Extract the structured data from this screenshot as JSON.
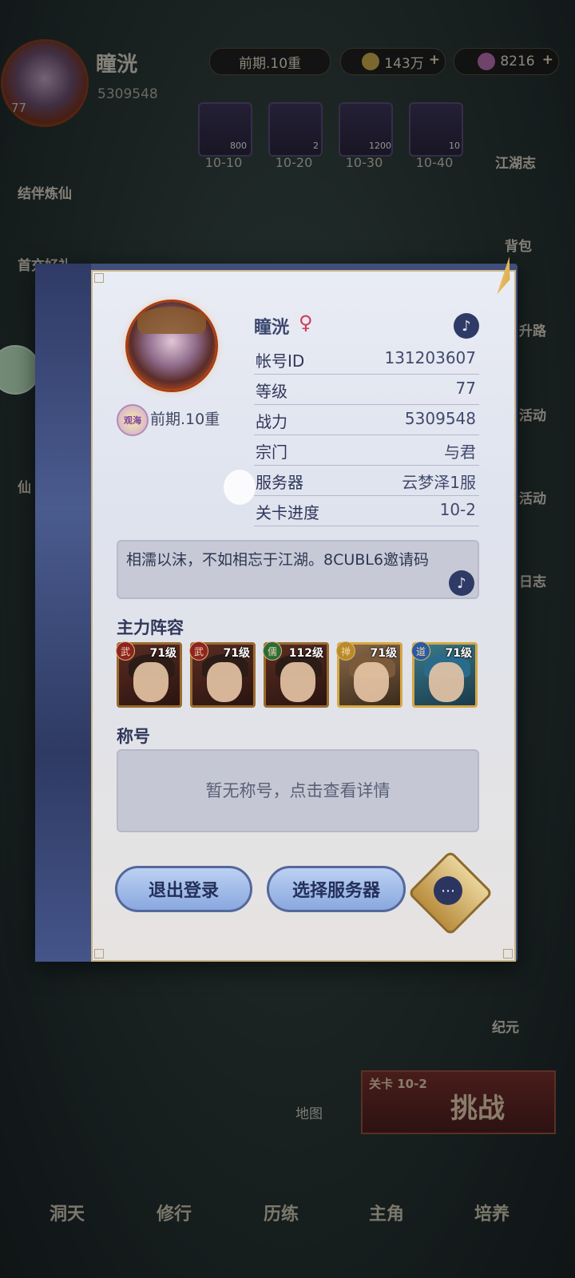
{
  "top": {
    "player_name": "瞳洸",
    "level": "77",
    "power": "5309548",
    "rank_badge": "观海",
    "rank_text": "前期.10重",
    "coins": "143万",
    "gems": "8216",
    "plus": "+"
  },
  "rewards": [
    {
      "count": "800",
      "label": "10-10"
    },
    {
      "count": "2",
      "label": "10-20"
    },
    {
      "count": "1200",
      "label": "10-30"
    },
    {
      "count": "10",
      "label": "10-40"
    }
  ],
  "side": {
    "left": [
      "结伴炼仙",
      "首充好礼",
      "仙"
    ],
    "right": [
      "江湖志",
      "背包",
      "升路",
      "活动",
      "活动",
      "日志",
      "纪元"
    ]
  },
  "bottom": {
    "map": "地图",
    "stage_label": "关卡 10-2",
    "challenge": "挑战",
    "nav": [
      "洞天",
      "修行",
      "历练",
      "主角",
      "培养"
    ]
  },
  "profile": {
    "name": "瞳洸",
    "gender_symbol": "♀",
    "rank_badge": "观海",
    "rank_text": "前期.10重",
    "rows": [
      {
        "key": "帐号ID",
        "value": "131203607"
      },
      {
        "key": "等级",
        "value": "77"
      },
      {
        "key": "战力",
        "value": "5309548"
      },
      {
        "key": "宗门",
        "value": "与君"
      },
      {
        "key": "服务器",
        "value": "云梦泽1服"
      },
      {
        "key": "关卡进度",
        "value": "10-2"
      }
    ],
    "bio": "相濡以沫，不如相忘于江湖。8CUBL6邀请码",
    "lineup_title": "主力阵容",
    "heroes": [
      {
        "badge": "武",
        "level": "71级"
      },
      {
        "badge": "武",
        "level": "71级"
      },
      {
        "badge": "儒",
        "level": "112级"
      },
      {
        "badge": "禅",
        "level": "71级"
      },
      {
        "badge": "道",
        "level": "71级"
      }
    ],
    "title_section": "称号",
    "title_placeholder": "暂无称号，点击查看详情",
    "logout": "退出登录",
    "select_server": "选择服务器",
    "more_icon": "⋯",
    "music_icon": "♪"
  }
}
